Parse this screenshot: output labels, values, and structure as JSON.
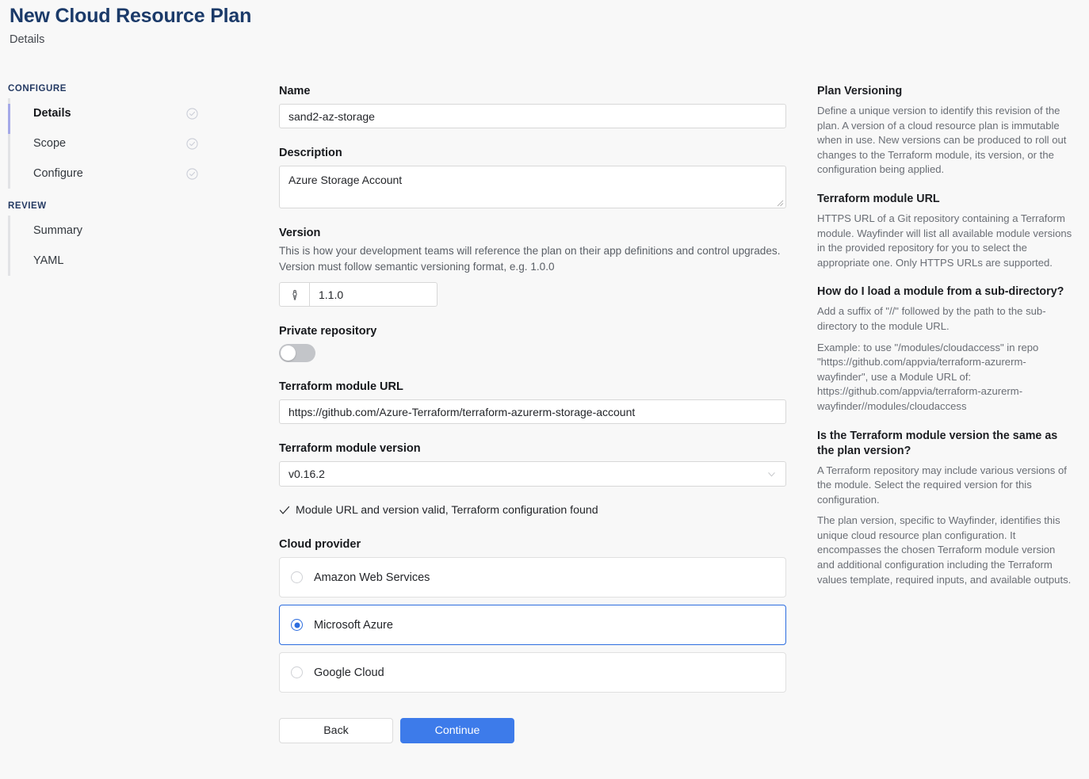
{
  "header": {
    "title": "New Cloud Resource Plan",
    "subtitle": "Details"
  },
  "sidebar": {
    "groups": [
      {
        "title": "CONFIGURE",
        "items": [
          {
            "label": "Details",
            "active": true,
            "check": true
          },
          {
            "label": "Scope",
            "active": false,
            "check": true
          },
          {
            "label": "Configure",
            "active": false,
            "check": true
          }
        ]
      },
      {
        "title": "REVIEW",
        "items": [
          {
            "label": "Summary",
            "active": false,
            "check": false
          },
          {
            "label": "YAML",
            "active": false,
            "check": false
          }
        ]
      }
    ]
  },
  "form": {
    "name": {
      "label": "Name",
      "value": "sand2-az-storage",
      "placeholder": ""
    },
    "description": {
      "label": "Description",
      "value": "Azure Storage Account",
      "placeholder": ""
    },
    "version": {
      "label": "Version",
      "help": "This is how your development teams will reference the plan on their app definitions and control upgrades. Version must follow semantic versioning format, e.g. 1.0.0",
      "value": "1.1.0",
      "icon": "git-branch-icon"
    },
    "private_repository": {
      "label": "Private repository",
      "enabled": false
    },
    "module_url": {
      "label": "Terraform module URL",
      "value": "https://github.com/Azure-Terraform/terraform-azurerm-storage-account",
      "placeholder": ""
    },
    "module_version": {
      "label": "Terraform module version",
      "value": "v0.16.2",
      "options": [
        "v0.16.2"
      ]
    },
    "validation": {
      "icon": "check-icon",
      "message": "Module URL and version valid, Terraform configuration found"
    },
    "cloud_provider": {
      "label": "Cloud provider",
      "selected": "Microsoft Azure",
      "options": [
        {
          "label": "Amazon Web Services",
          "selected": false
        },
        {
          "label": "Microsoft Azure",
          "selected": true
        },
        {
          "label": "Google Cloud",
          "selected": false
        }
      ]
    },
    "buttons": {
      "back": "Back",
      "continue": "Continue"
    }
  },
  "help": {
    "sections": [
      {
        "title": "Plan Versioning",
        "paragraphs": [
          "Define a unique version to identify this revision of the plan. A version of a cloud resource plan is immutable when in use. New versions can be produced to roll out changes to the Terraform module, its version, or the configuration being applied."
        ]
      },
      {
        "title": "Terraform module URL",
        "paragraphs": [
          "HTTPS URL of a Git repository containing a Terraform module. Wayfinder will list all available module versions in the provided repository for you to select the appropriate one. Only HTTPS URLs are supported."
        ]
      },
      {
        "title": "How do I load a module from a sub-directory?",
        "paragraphs": [
          "Add a suffix of \"//\" followed by the path to the sub-directory to the module URL.",
          "Example: to use \"/modules/cloudaccess\" in repo \"https://github.com/appvia/terraform-azurerm-wayfinder\", use a Module URL of: https://github.com/appvia/terraform-azurerm-wayfinder//modules/cloudaccess"
        ]
      },
      {
        "title": "Is the Terraform module version the same as the plan version?",
        "paragraphs": [
          "A Terraform repository may include various versions of the module. Select the required version for this configuration.",
          "The plan version, specific to Wayfinder, identifies this unique cloud resource plan configuration. It encompasses the chosen Terraform module version and additional configuration including the Terraform values template, required inputs, and available outputs."
        ]
      }
    ]
  },
  "colors": {
    "title": "#1b3a69",
    "accent_blue": "#3d7bea",
    "selected_border": "#2c6ddf",
    "active_rail": "#a5a9e8",
    "background": "#f8f8f8"
  }
}
